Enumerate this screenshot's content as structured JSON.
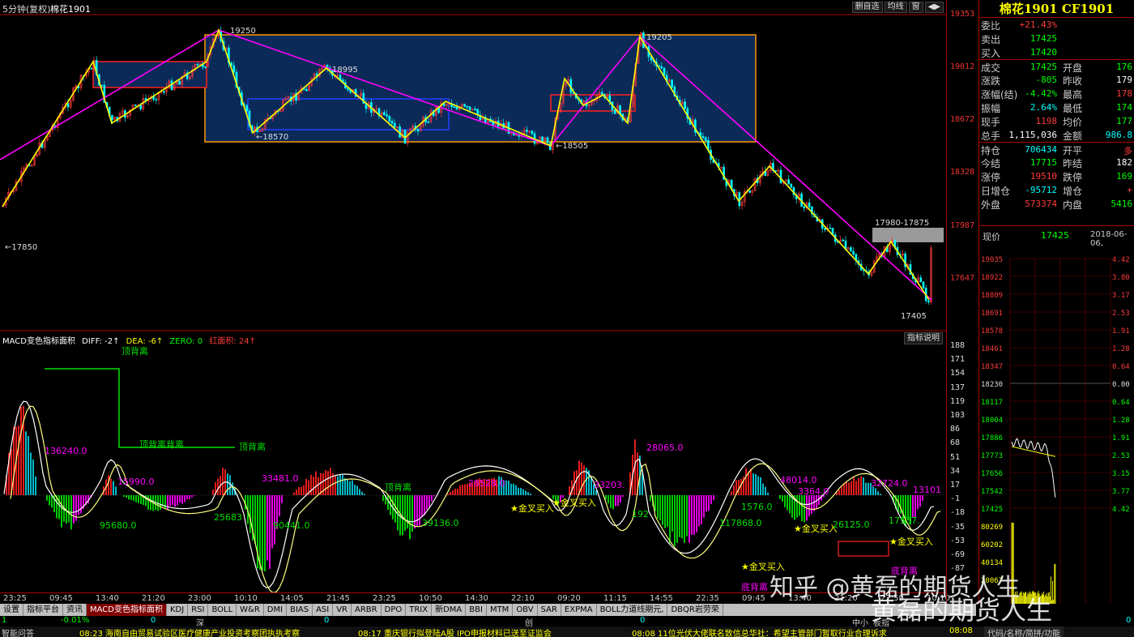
{
  "topbar": {
    "period": "5分钟(复权)",
    "symbol": "棉花1901",
    "btn_delete": "删自选",
    "btn_avg": "均线",
    "btn_window": "窗",
    "btn_scroll": "◀▶"
  },
  "price_axis": [
    "19353",
    "19012",
    "18672",
    "18328",
    "17987",
    "17647"
  ],
  "macd_axis": [
    "188",
    "171",
    "154",
    "137",
    "119",
    "103",
    "86",
    "68",
    "51",
    "34",
    "17",
    "-1",
    "-18",
    "-35",
    "-53",
    "-69",
    "-87"
  ],
  "price_annotations": {
    "p19250": "19250",
    "p18995": "18995",
    "p18570": "←18570",
    "p18505": "←18505",
    "p19205": "19205",
    "p17850": "←17850",
    "p17405": "17405",
    "zone": "17980-17875"
  },
  "macd_header": {
    "name": "MACD变色指标面积",
    "diff": "DIFF: -2↑",
    "dea": "DEA: -6↑",
    "zero": "ZERO: 0",
    "area": "红面积: 24↑"
  },
  "indicator_btn": "指标说明",
  "macd_annotations": {
    "a1": "136240.0",
    "a2": "15990.0",
    "a3": "95680.0",
    "a4": "25683",
    "a5": "33481.0",
    "a6": "90441.0",
    "a7": "28528.0",
    "a8": "39136.0",
    "a9": "28065.0",
    "a10": "192",
    "a11": "117868.0",
    "a12": "1576.0",
    "a13": "48014.0",
    "a14": "32724.0",
    "a15": "17537.",
    "a16": "13101",
    "a17": "33203.",
    "a18": "1576.0",
    "a19": "3364.0",
    "a20": "26125.0",
    "div1": "顶背离",
    "div2": "顶背离背离",
    "div3": "顶背离",
    "div4": "顶背离",
    "div5": "底背离",
    "div6": "底背离",
    "gc1": "★金叉买入",
    "gc2": "★金叉买入",
    "gc3": "★金叉买入",
    "gc4": "★金叉买入",
    "gc5": "★金叉买入"
  },
  "time_axis": [
    "23:25",
    "09:45",
    "13:40",
    "21:20",
    "23:00",
    "10:10",
    "14:05",
    "21:45",
    "23:25",
    "10:50",
    "14:30",
    "22:10",
    "09:20",
    "11:15",
    "14:55",
    "22:35",
    "09:45",
    "13:40",
    "21:20",
    "22:59",
    "10:10"
  ],
  "tabs": [
    "设置",
    "指标平台",
    "资讯",
    "MACD变色指标面积",
    "KDJ",
    "RSI",
    "BOLL",
    "W&R",
    "DMI",
    "BIAS",
    "ASI",
    "VR",
    "ARBR",
    "DPO",
    "TRIX",
    "新DMA",
    "BBI",
    "MTM",
    "OBV",
    "SAR",
    "EXPMA",
    "BOLL力道线期元,",
    "DBQR岩劳荣"
  ],
  "status1": {
    "s1": "1",
    "s2": "-0.01%",
    "s3": "0",
    "s4": "深",
    "s5": "0",
    "s6": "创",
    "s7": "0",
    "s8": "中小",
    "s9": "板指",
    "s10": "0"
  },
  "status2": {
    "t1": "智能问答",
    "t2": "08:23 海南自由贸易试验区医疗健康产业投资考察团执执考察",
    "t3": "08:17 重庆银行拟登陆A股 IPO申报材料已送至证监会",
    "t4": "08:08 11位光伏大佬联名致信总华社：希望主管部门暂取行业合理诉求",
    "t5": "08:08",
    "t6": "代码/名称/简拼/功能"
  },
  "right_panel": {
    "title": "棉花1901 CF1901",
    "rows": [
      {
        "l1": "委比",
        "v1": "+21.43%",
        "c1": "red",
        "l2": "",
        "v2": "",
        "c2": ""
      },
      {
        "l1": "卖出",
        "v1": "17425",
        "c1": "green",
        "l2": "",
        "v2": "",
        "c2": ""
      },
      {
        "l1": "买入",
        "v1": "17420",
        "c1": "green",
        "l2": "",
        "v2": "",
        "c2": ""
      },
      {
        "l1": "成交",
        "v1": "17425",
        "c1": "green",
        "l2": "开盘",
        "v2": "176",
        "c2": "green"
      },
      {
        "l1": "涨跌",
        "v1": "-805",
        "c1": "green",
        "l2": "昨收",
        "v2": "179",
        "c2": "white"
      },
      {
        "l1": "涨幅(结)",
        "v1": "-4.42%",
        "c1": "green",
        "l2": "最高",
        "v2": "178",
        "c2": "red"
      },
      {
        "l1": "振幅",
        "v1": "2.64%",
        "c1": "cyan",
        "l2": "最低",
        "v2": "174",
        "c2": "green"
      },
      {
        "l1": "现手",
        "v1": "1198",
        "c1": "red",
        "l2": "均价",
        "v2": "177",
        "c2": "green"
      },
      {
        "l1": "总手",
        "v1": "1,115,036",
        "c1": "white",
        "l2": "金额",
        "v2": "986.8",
        "c2": "cyan"
      },
      {
        "l1": "持仓",
        "v1": "706434",
        "c1": "cyan",
        "l2": "开平",
        "v2": "多",
        "c2": "red"
      },
      {
        "l1": "今结",
        "v1": "17715",
        "c1": "green",
        "l2": "昨结",
        "v2": "182",
        "c2": "white"
      },
      {
        "l1": "涨停",
        "v1": "19510",
        "c1": "red",
        "l2": "跌停",
        "v2": "169",
        "c2": "green"
      },
      {
        "l1": "日增仓",
        "v1": "-95712",
        "c1": "cyan",
        "l2": "增仓",
        "v2": "+",
        "c2": "red"
      },
      {
        "l1": "外盘",
        "v1": "573374",
        "c1": "red",
        "l2": "内盘",
        "v2": "5416",
        "c2": "green"
      }
    ],
    "now_label": "现价",
    "now_value": "17425",
    "now_date": "2018-06-06,",
    "mini_left": [
      "19035",
      "18922",
      "18809",
      "18691",
      "18578",
      "18461",
      "18347",
      "18230",
      "18117",
      "18004",
      "17886",
      "17773",
      "17656",
      "17542",
      "17425"
    ],
    "mini_right": [
      "4.42",
      "3.80",
      "3.17",
      "2.53",
      "1.91",
      "1.28",
      "0.64",
      "0.00",
      "0.64",
      "1.28",
      "1.91",
      "2.53",
      "3.15",
      "3.77",
      "4.42"
    ],
    "vol_labels": [
      "80269",
      "60202",
      "40134",
      "20067"
    ]
  },
  "watermark": {
    "line1": "知乎 @黄磊的期货人生",
    "line2": "黄磊的期货人生"
  },
  "colors": {
    "up": "#ff3b3b",
    "down": "#00ffff",
    "macd_pos": "#ff2020",
    "macd_neg_green": "#00e000",
    "macd_neg_magenta": "#ff00ff",
    "zigzag": "#ffff00",
    "trend": "#ff00ff",
    "box_orange": "#ff9900",
    "box_fill": "#0a2a55"
  }
}
